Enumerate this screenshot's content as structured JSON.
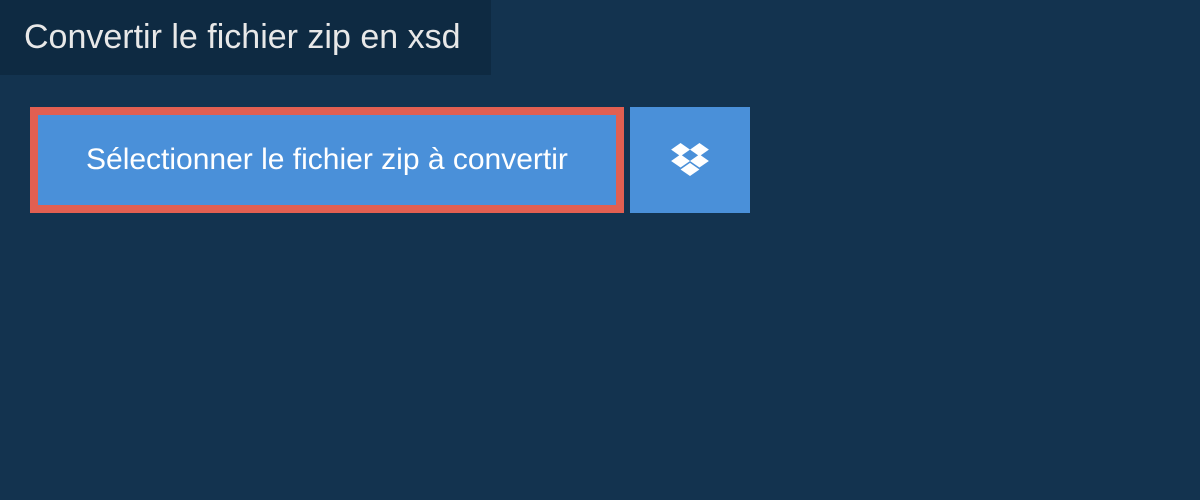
{
  "header": {
    "title": "Convertir le fichier zip en xsd"
  },
  "actions": {
    "select_file_label": "Sélectionner le fichier zip à convertir"
  },
  "colors": {
    "background": "#13334f",
    "title_bg": "#0e2a42",
    "button_bg": "#4a90d9",
    "highlight_border": "#e15f51"
  }
}
